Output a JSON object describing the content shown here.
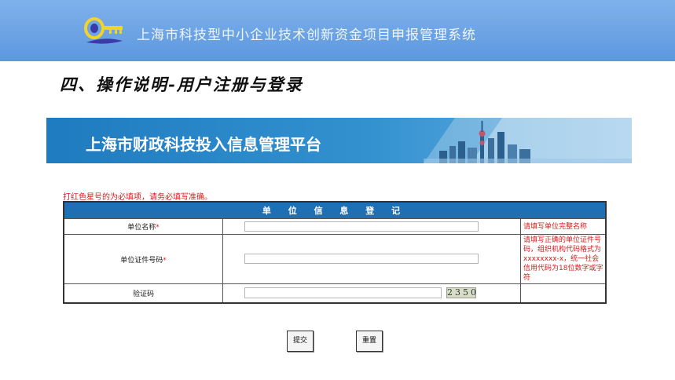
{
  "header": {
    "app_title": "上海市科技型中小企业技术创新资金项目申报管理系统",
    "logo_icon": "key-logo-icon"
  },
  "slide": {
    "heading": "四、操作说明-用户注册与登录"
  },
  "platform": {
    "title": "上海市财政科技投入信息管理平台"
  },
  "form": {
    "required_note": "打红色星号的为必填项，请务必填写准确。",
    "title": "单 位 信 息 登 记",
    "rows": [
      {
        "label": "单位名称",
        "required_mark": "*",
        "value": "",
        "hint": "请填写单位完整名称"
      },
      {
        "label": "单位证件号码",
        "required_mark": "*",
        "value": "",
        "hint": "请填写正确的单位证件号码，组织机构代码格式为xxxxxxxx-x，统一社会信用代码为18位数字或字符"
      },
      {
        "label": "验证码",
        "required_mark": "",
        "value": "",
        "hint": "",
        "captcha_text": "2350"
      }
    ]
  },
  "buttons": {
    "submit": "提交",
    "reset": "重置"
  },
  "colors": {
    "top_bar": "#6aa3e4",
    "banner": "#1f7bbf",
    "table_header": "#1f6fb4",
    "required": "#d42020"
  }
}
